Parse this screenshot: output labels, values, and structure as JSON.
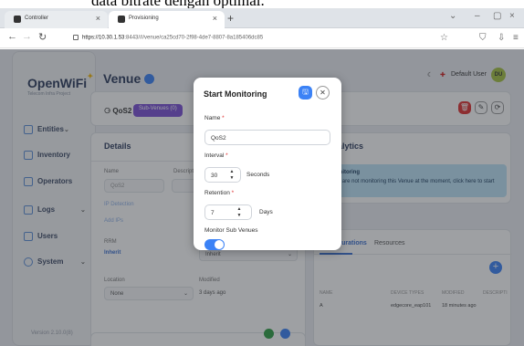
{
  "caption": {
    "text": "data bitrate dengan optimal."
  },
  "browser": {
    "tabs": [
      {
        "label": "Controller",
        "active": false
      },
      {
        "label": "Provisioning",
        "active": true
      }
    ],
    "new_tab": "+",
    "url_host": "https://10.30.1.53",
    "url_rest": ":8443/#/venue/ca25cd70-2f98-4de7-8807-8a185406dc85"
  },
  "sidebar": {
    "logo": "OpenWiFi",
    "logo_sub": "Telecom Infra Project",
    "items": [
      {
        "label": "Entities",
        "icon": "entities-icon"
      },
      {
        "label": "Inventory",
        "icon": "inventory-icon"
      },
      {
        "label": "Operators",
        "icon": "operators-icon"
      },
      {
        "label": "Logs",
        "icon": "logs-icon"
      },
      {
        "label": "Users",
        "icon": "users-icon"
      },
      {
        "label": "System",
        "icon": "system-icon"
      }
    ],
    "version": "Version 2.10.0(8)"
  },
  "header": {
    "title": "Venue",
    "user": "Default User",
    "user_initials": "DU"
  },
  "venue_card": {
    "name": "QoS2",
    "sub_venues_button": "Sub-Venues (0)"
  },
  "details": {
    "title": "Details",
    "name_label": "Name",
    "name_value": "QoS2",
    "description_label": "Description",
    "ip_detection_label": "IP Detection",
    "add_ips_label": "Add IPs",
    "rrm_label": "RRM",
    "rrm_value": "Inherit",
    "rrm_select_value": "Inherit",
    "location_label": "Location",
    "location_value": "None",
    "modified_label": "Modified",
    "modified_value": "3 days ago"
  },
  "analytics": {
    "title": "Analytics",
    "alert_title": "Monitoring",
    "alert_text": "You are not monitoring this Venue at the moment, click here to start"
  },
  "configurations": {
    "tabs": [
      "Configurations",
      "Resources"
    ],
    "columns": [
      "NAME",
      "DEVICE TYPES",
      "MODIFIED",
      "DESCRIPTI"
    ],
    "rows": [
      {
        "name": "A",
        "device_types": "edgecore_eap101",
        "modified": "18 minutes ago",
        "description": ""
      }
    ]
  },
  "modal": {
    "title": "Start Monitoring",
    "name_label": "Name",
    "name_value": "QoS2",
    "interval_label": "Interval",
    "interval_value": "30",
    "interval_unit": "Seconds",
    "retention_label": "Retention",
    "retention_value": "7",
    "retention_unit": "Days",
    "monitor_sub_label": "Monitor Sub Venues",
    "monitor_sub_enabled": true
  },
  "colors": {
    "accent": "#3b82f6",
    "sub_venues": "#7a4fd6",
    "danger": "#e03131",
    "alert_bg": "#bee3f8"
  }
}
